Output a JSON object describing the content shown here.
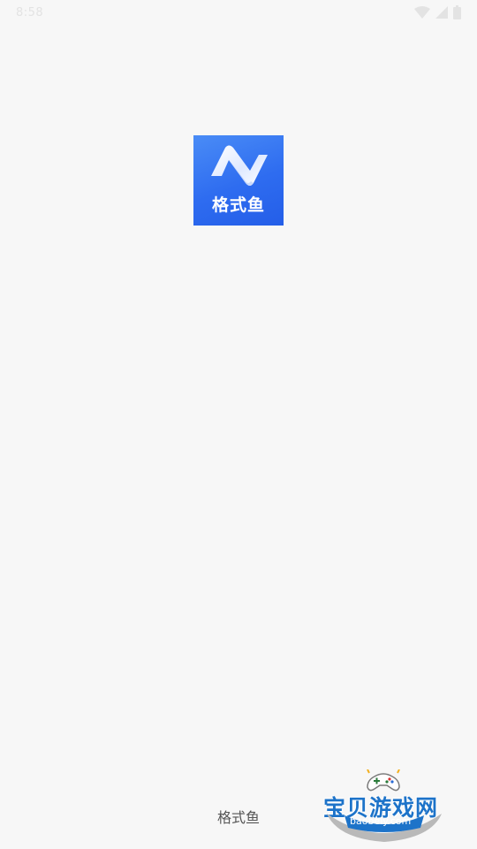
{
  "status_bar": {
    "time": "8:58",
    "icons": [
      "wifi-icon",
      "signal-icon",
      "battery-icon"
    ]
  },
  "splash": {
    "app_icon_label": "格式鱼",
    "app_name": "格式鱼"
  },
  "watermark": {
    "title": "宝贝游戏网",
    "url": "baobeiy.com"
  },
  "colors": {
    "background": "#f7f7f7",
    "icon_blue": "#2e6cf0",
    "watermark_blue": "#1d73c9"
  }
}
